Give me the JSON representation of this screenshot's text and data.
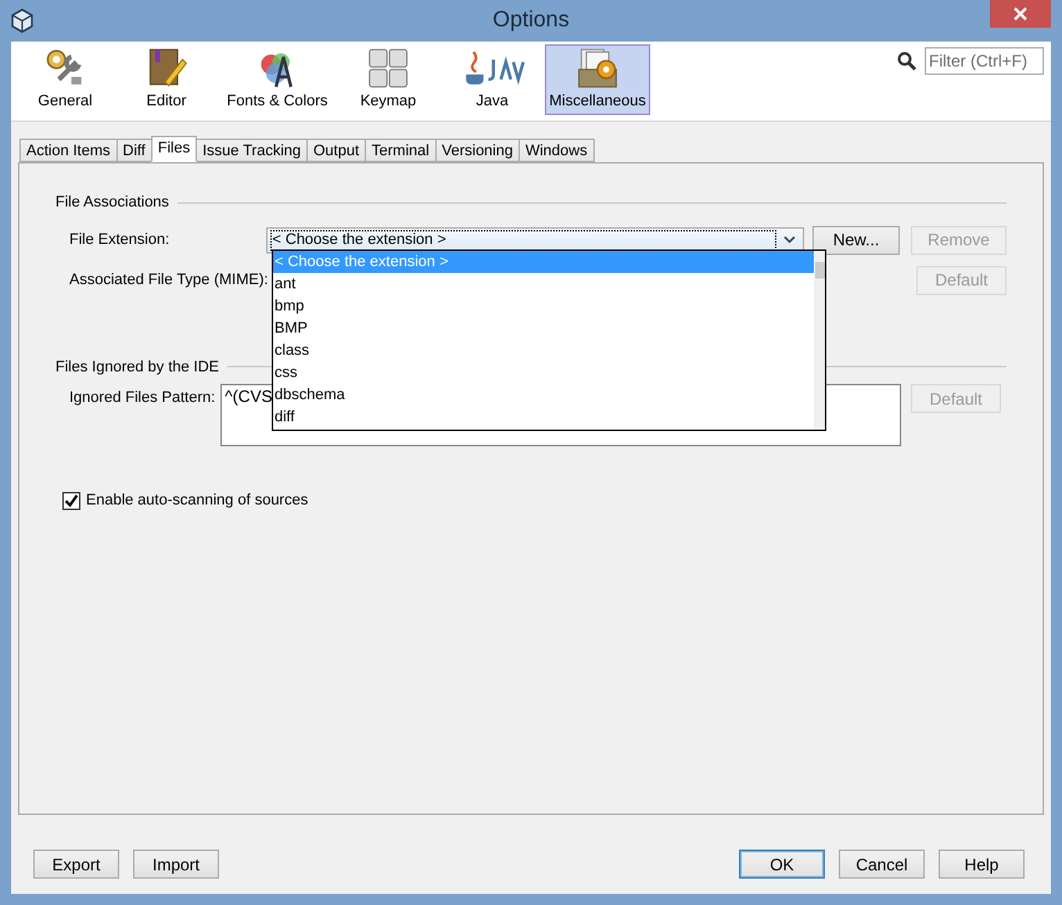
{
  "window": {
    "title": "Options"
  },
  "categories": [
    {
      "kind": "general",
      "label": "General",
      "selected": false
    },
    {
      "kind": "editor",
      "label": "Editor",
      "selected": false
    },
    {
      "kind": "fonts",
      "label": "Fonts & Colors",
      "selected": false
    },
    {
      "kind": "keymap",
      "label": "Keymap",
      "selected": false
    },
    {
      "kind": "java",
      "label": "Java",
      "selected": false
    },
    {
      "kind": "misc",
      "label": "Miscellaneous",
      "selected": true
    }
  ],
  "filter": {
    "placeholder": "Filter (Ctrl+F)"
  },
  "tabs": [
    {
      "label": "Action Items",
      "selected": false
    },
    {
      "label": "Diff",
      "selected": false
    },
    {
      "label": "Files",
      "selected": true
    },
    {
      "label": "Issue Tracking",
      "selected": false
    },
    {
      "label": "Output",
      "selected": false
    },
    {
      "label": "Terminal",
      "selected": false
    },
    {
      "label": "Versioning",
      "selected": false
    },
    {
      "label": "Windows",
      "selected": false
    }
  ],
  "file_associations": {
    "title": "File Associations",
    "extension_label": "File Extension:",
    "extension_value": "< Choose the extension >",
    "new_button": {
      "label": "New...",
      "disabled": false
    },
    "remove_button": {
      "label": "Remove",
      "disabled": true
    },
    "mime_label": "Associated File Type (MIME):",
    "mime_default_button": {
      "label": "Default",
      "disabled": true
    }
  },
  "dropdown_items": [
    {
      "label": "< Choose the extension >",
      "selected": true
    },
    {
      "label": "ant",
      "selected": false
    },
    {
      "label": "bmp",
      "selected": false
    },
    {
      "label": "BMP",
      "selected": false
    },
    {
      "label": "class",
      "selected": false
    },
    {
      "label": "css",
      "selected": false
    },
    {
      "label": "dbschema",
      "selected": false
    },
    {
      "label": "diff",
      "selected": false
    }
  ],
  "files_ignored": {
    "title": "Files Ignored by the IDE",
    "pattern_label": "Ignored Files Pattern:",
    "pattern_value": "^(CVS",
    "default_button": {
      "label": "Default",
      "disabled": true
    }
  },
  "auto_scan": {
    "label": "Enable auto-scanning of sources",
    "checked": true
  },
  "footer_left": [
    {
      "label": "Export",
      "default": false
    },
    {
      "label": "Import",
      "default": false
    }
  ],
  "footer_right": [
    {
      "label": "OK",
      "default": true
    },
    {
      "label": "Cancel",
      "default": false
    },
    {
      "label": "Help",
      "default": false
    }
  ]
}
